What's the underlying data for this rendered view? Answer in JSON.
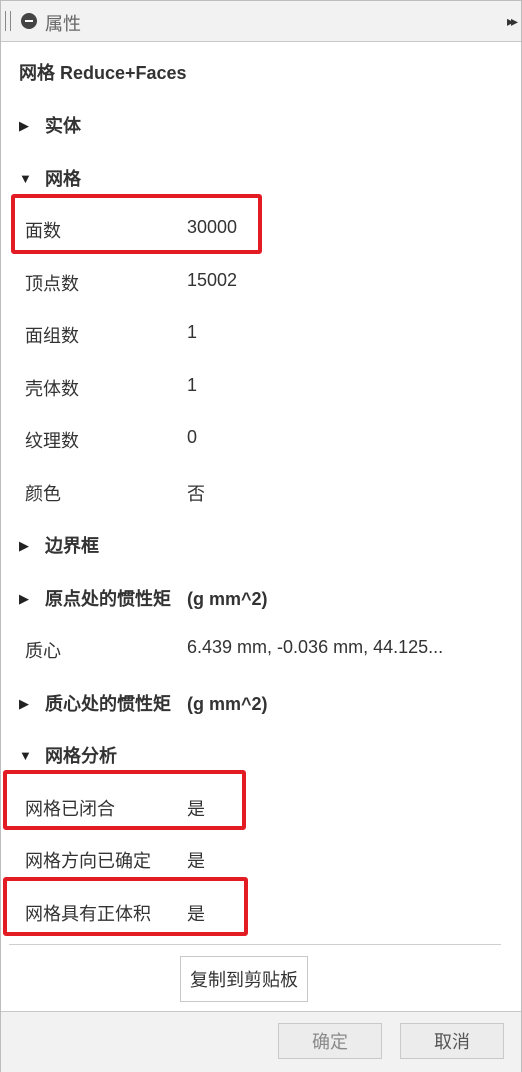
{
  "titlebar": {
    "title": "属性",
    "expand_symbol": "▸▸"
  },
  "component_name": "网格 Reduce+Faces",
  "sections": {
    "solid": {
      "label": "实体",
      "state": "collapsed"
    },
    "mesh": {
      "label": "网格",
      "state": "expanded"
    },
    "bounding_box": {
      "label": "边界框",
      "state": "collapsed"
    },
    "inertia_origin": {
      "label": "原点处的惯性矩",
      "unit": "(g mm^2)",
      "state": "collapsed"
    },
    "inertia_com": {
      "label": "质心处的惯性矩",
      "unit": "(g mm^2)",
      "state": "collapsed"
    },
    "mesh_analysis": {
      "label": "网格分析",
      "state": "expanded"
    }
  },
  "mesh": {
    "faces": {
      "label": "面数",
      "value": "30000"
    },
    "vertices": {
      "label": "顶点数",
      "value": "15002"
    },
    "face_groups": {
      "label": "面组数",
      "value": "1"
    },
    "shells": {
      "label": "壳体数",
      "value": "1"
    },
    "textures": {
      "label": "纹理数",
      "value": "0"
    },
    "color": {
      "label": "颜色",
      "value": "否"
    }
  },
  "center_of_mass": {
    "label": "质心",
    "value": "6.439 mm, -0.036 mm, 44.125..."
  },
  "analysis": {
    "closed": {
      "label": "网格已闭合",
      "value": "是"
    },
    "oriented": {
      "label": "网格方向已确定",
      "value": "是"
    },
    "positive_volume": {
      "label": "网格具有正体积",
      "value": "是"
    }
  },
  "buttons": {
    "copy": "复制到剪贴板",
    "ok": "确定",
    "cancel": "取消"
  },
  "colors": {
    "highlight": "#e31b23",
    "header_bg": "#f2f2f2"
  },
  "icons": {
    "collapsed": "▶",
    "expanded": "▼"
  }
}
